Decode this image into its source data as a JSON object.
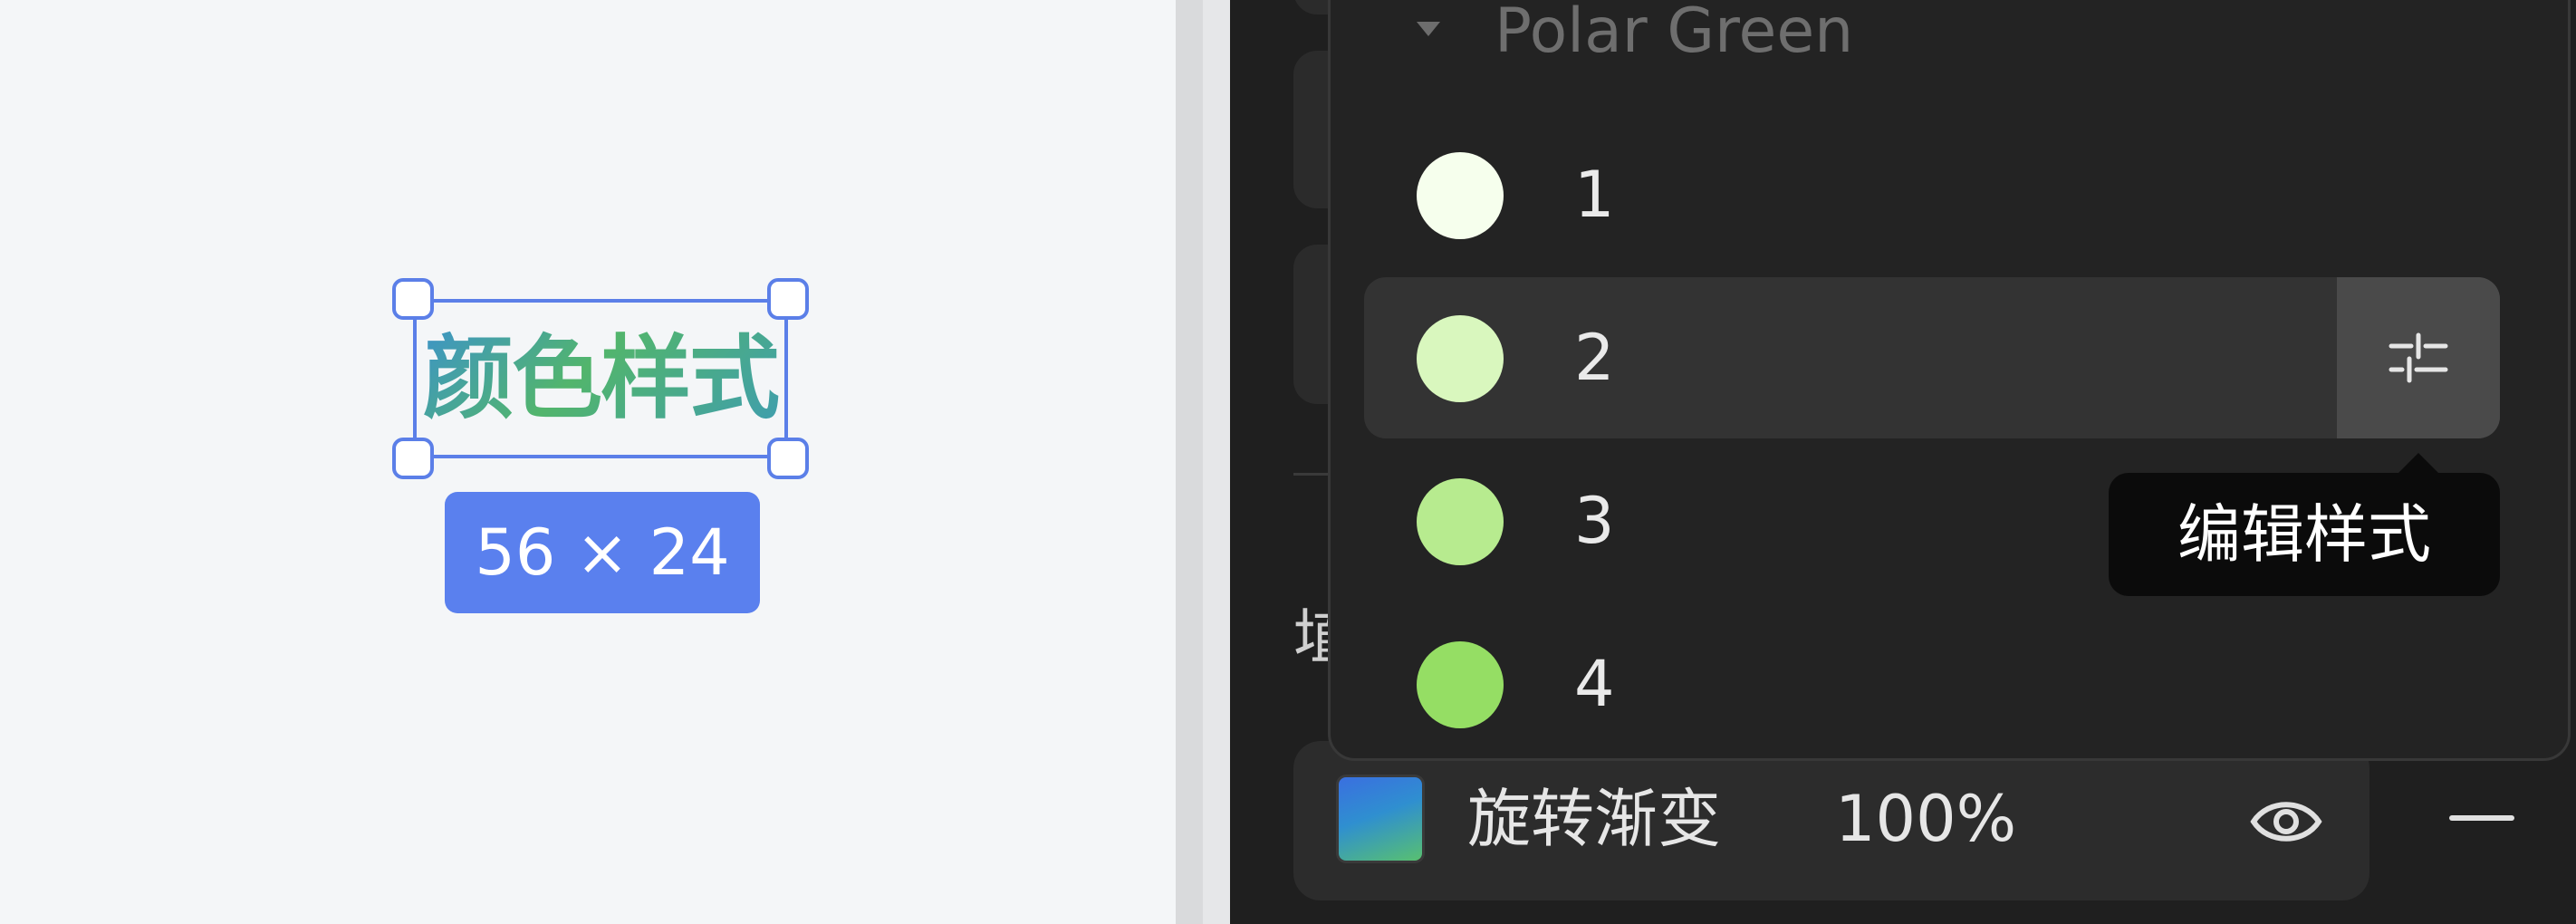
{
  "canvas": {
    "selected_text": "颜色样式",
    "size_badge": "56 × 24"
  },
  "fill": {
    "partial_label": "埴",
    "name": "旋转渐变",
    "opacity": "100%"
  },
  "dropdown": {
    "group_title": "Polar Green",
    "items": [
      {
        "label": "1",
        "color": "#f6ffed"
      },
      {
        "label": "2",
        "color": "#d9f7be"
      },
      {
        "label": "3",
        "color": "#b7eb8f"
      },
      {
        "label": "4",
        "color": "#95de64"
      }
    ],
    "tooltip": "编辑样式"
  },
  "theme": {
    "selection": "#5b7fe8",
    "badge": "#5a80ee",
    "panel_bg": "#1f1f1f"
  },
  "icons": [
    "caret-down-icon",
    "style-settings-icon",
    "eye-icon",
    "remove-icon"
  ]
}
